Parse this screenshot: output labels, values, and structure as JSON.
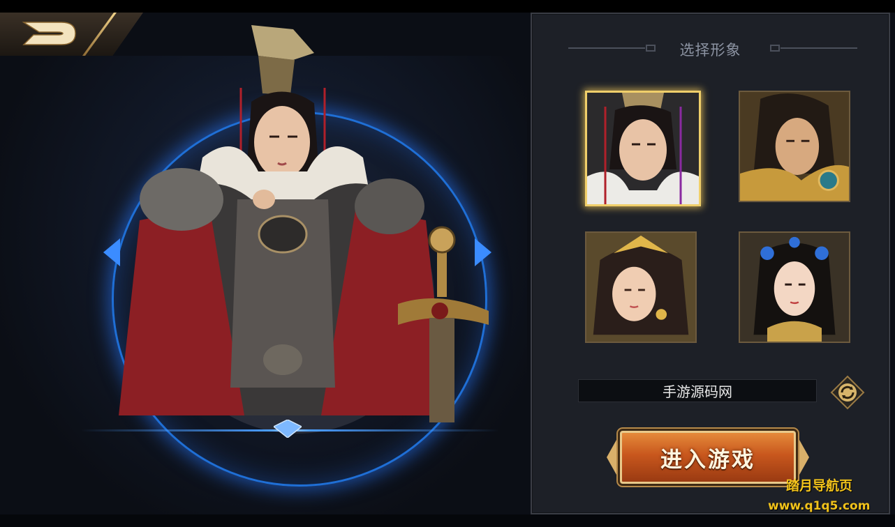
{
  "panel": {
    "title": "选择形象"
  },
  "portraits": [
    {
      "name": "portrait-male-warlord",
      "selected": true
    },
    {
      "name": "portrait-male-warrior",
      "selected": false
    },
    {
      "name": "portrait-female-golden",
      "selected": false
    },
    {
      "name": "portrait-female-blue",
      "selected": false
    }
  ],
  "name_input": {
    "value": "手游源码网"
  },
  "enter_button": {
    "label": "进入游戏"
  },
  "watermark": {
    "line1": "踏月导航页",
    "line2": "www.q1q5.com"
  },
  "colors": {
    "accent_gold": "#f0cf6a",
    "ring_blue": "#1f6fd6",
    "button_orange": "#c8571d",
    "watermark_yellow": "#f1c21b"
  },
  "icons": {
    "back": "back-arrow-icon",
    "random": "dice-refresh-icon"
  }
}
